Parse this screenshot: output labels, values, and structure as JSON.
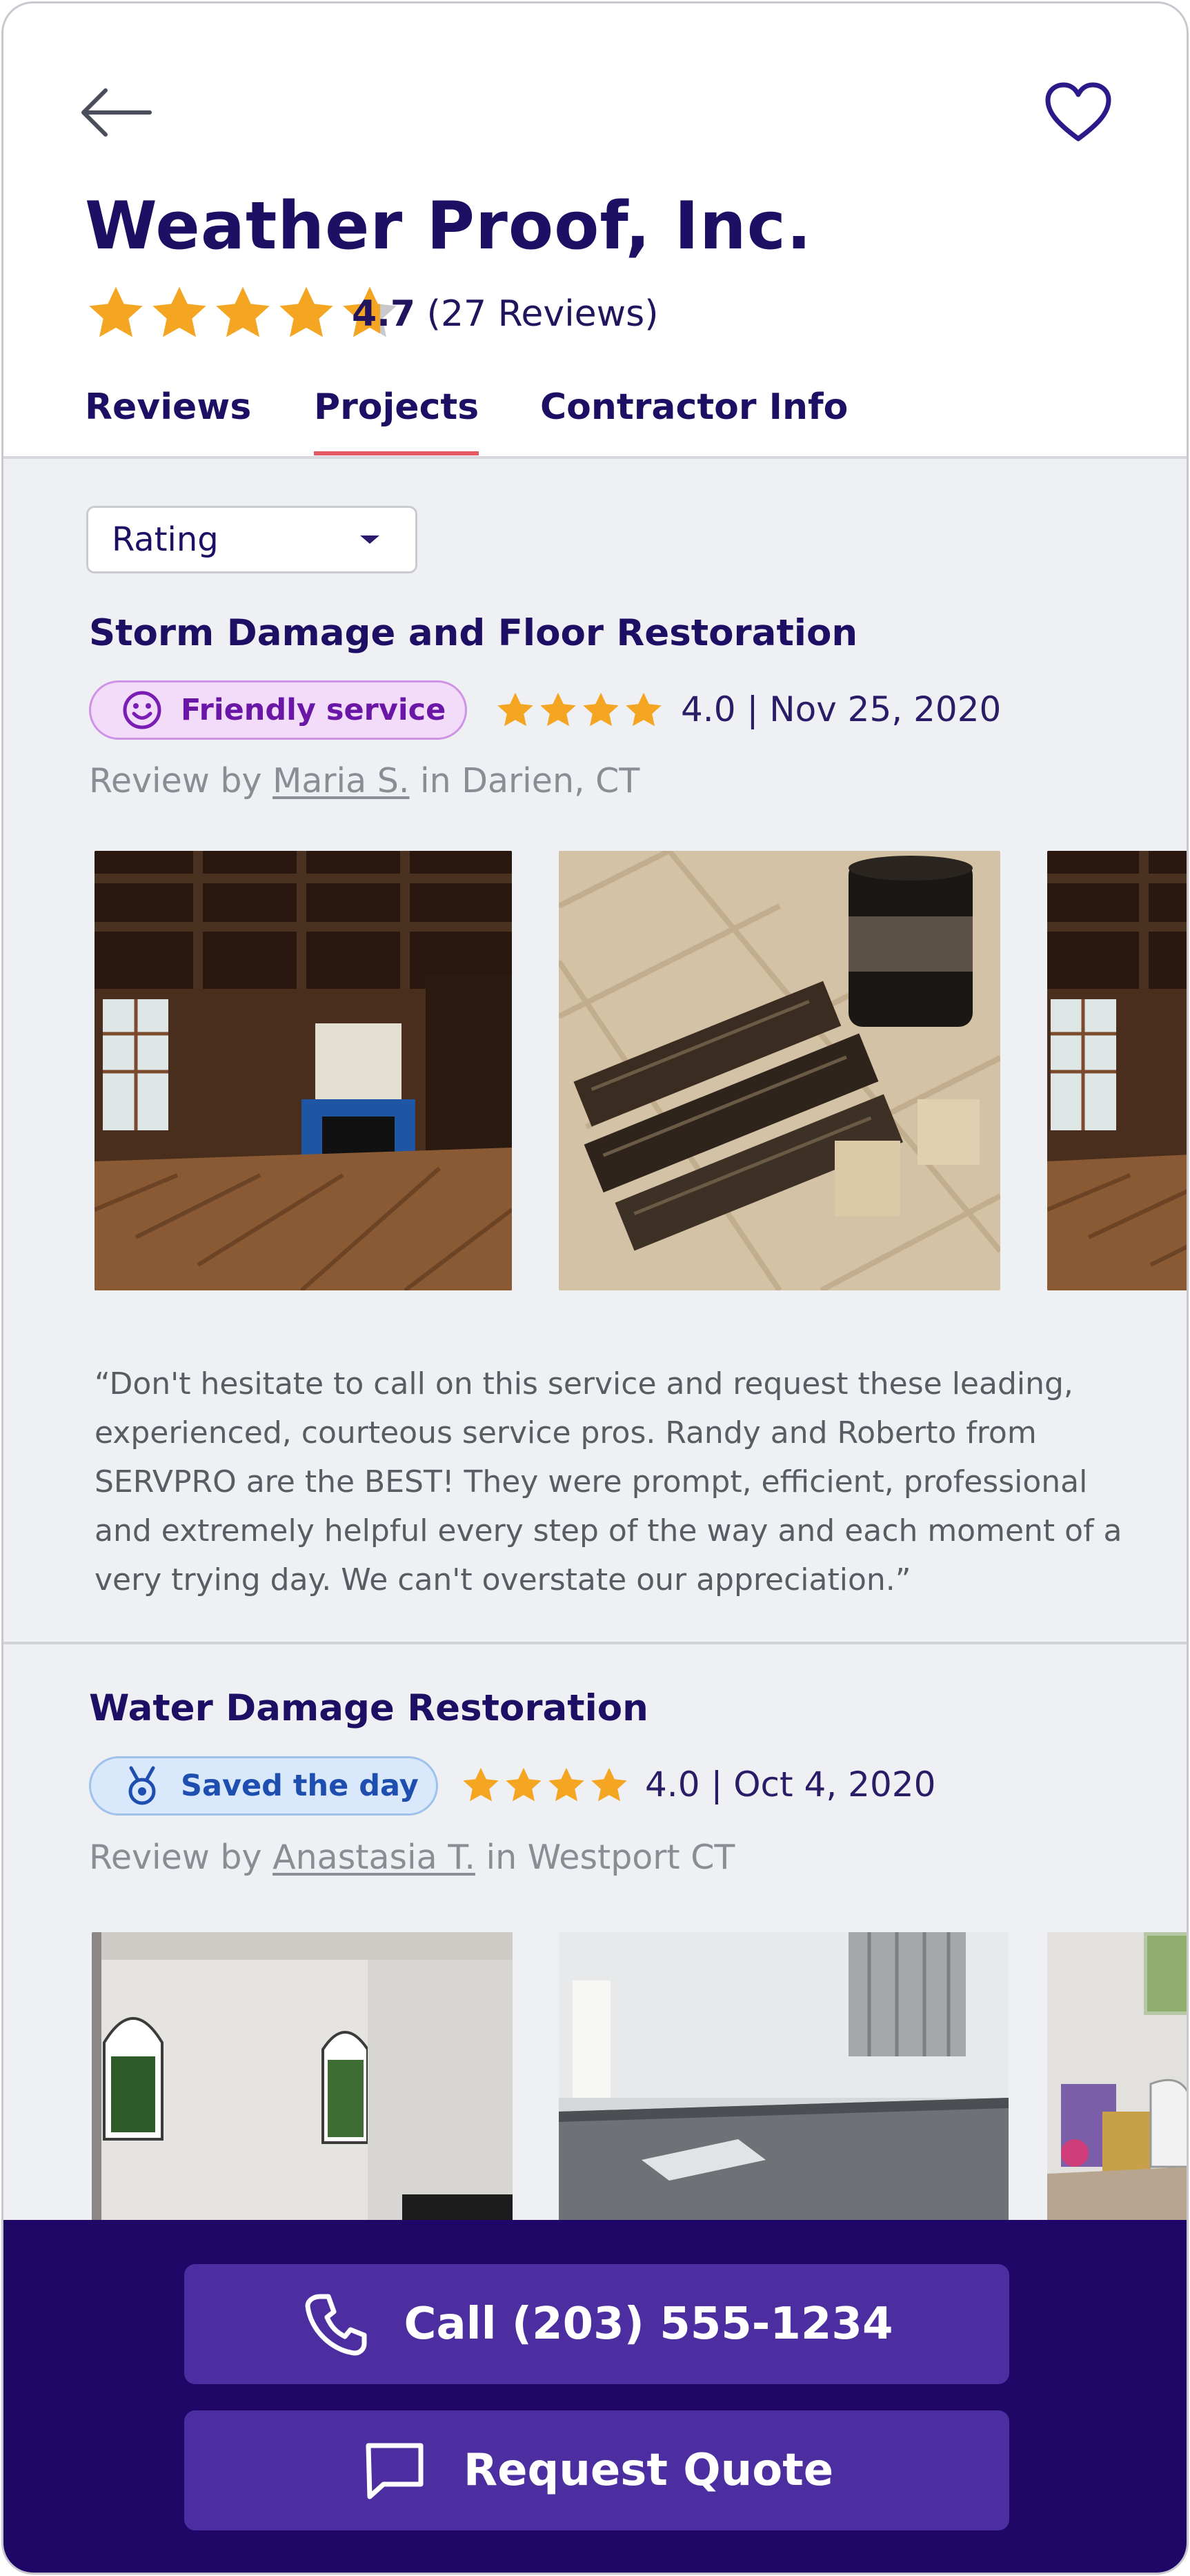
{
  "business": {
    "name": "Weather Proof, Inc.",
    "rating": "4.7",
    "reviews_count": "(27 Reviews)",
    "stars_filled": 4.7
  },
  "tabs": [
    {
      "label": "Reviews",
      "active": false
    },
    {
      "label": "Projects",
      "active": true
    },
    {
      "label": "Contractor Info",
      "active": false
    }
  ],
  "sort": {
    "selected": "Rating"
  },
  "reviews": [
    {
      "title": "Storm Damage and Floor Restoration",
      "badge": "Friendly service",
      "badge_icon": "smiley-icon",
      "rating": "4.0",
      "separator": "|",
      "date": "Nov 25, 2020",
      "by_prefix": "Review by",
      "author": "Maria S.",
      "location": "in Darien, CT",
      "quote": "“Don't hesitate to call on this service and request these leading, experienced, courteous service pros. Randy and Roberto from SERVPRO are the BEST! They were prompt, efficient, professional and extremely helpful every step of the way and each moment of a very trying day. We can't overstate our appreciation.”"
    },
    {
      "title": "Water Damage Restoration",
      "badge": "Saved the day",
      "badge_icon": "medal-icon",
      "rating": "4.0",
      "separator": "|",
      "date": "Oct 4, 2020",
      "by_prefix": "Review by",
      "author": "Anastasia T.",
      "location": "in Westport CT"
    }
  ],
  "cta": {
    "call_label": "Call (203) 555-1234",
    "quote_label": "Request Quote"
  },
  "colors": {
    "brand": "#1d0f63",
    "star": "#f4a623",
    "tab_underline": "#e45a63",
    "cta_bar": "#1e0766",
    "cta_button": "#4d2ea0"
  }
}
